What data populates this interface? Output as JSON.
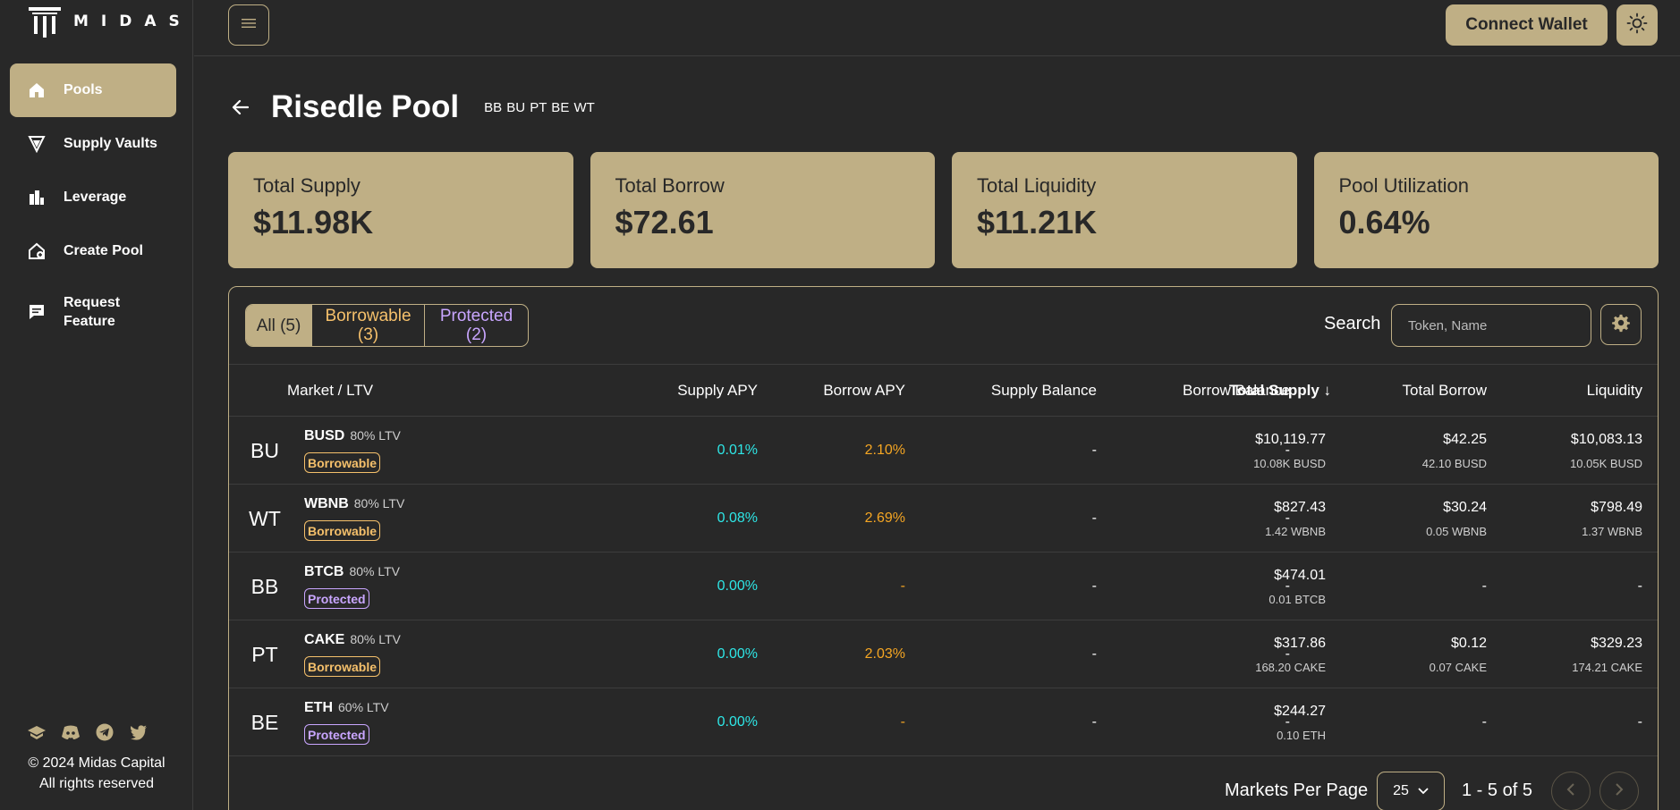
{
  "app": {
    "logo_text": "MIDAS"
  },
  "sidebar": {
    "items": [
      {
        "label": "Pools",
        "icon": "pools-icon",
        "active": true
      },
      {
        "label": "Supply Vaults",
        "icon": "supply-vaults-icon"
      },
      {
        "label": "Leverage",
        "icon": "leverage-icon"
      },
      {
        "label": "Create Pool",
        "icon": "create-pool-icon"
      },
      {
        "label": "Request Feature",
        "icon": "request-feature-icon"
      }
    ],
    "social": [
      "docs-icon",
      "discord-icon",
      "telegram-icon",
      "twitter-icon"
    ],
    "copyright_line1": "© 2024 Midas Capital",
    "copyright_line2": "All rights reserved"
  },
  "topbar": {
    "connect_label": "Connect Wallet"
  },
  "pool": {
    "title": "Risedle Pool",
    "tags": "BB BU PT BE WT"
  },
  "stats": [
    {
      "label": "Total Supply",
      "value": "$11.98K"
    },
    {
      "label": "Total Borrow",
      "value": "$72.61"
    },
    {
      "label": "Total Liquidity",
      "value": "$11.21K"
    },
    {
      "label": "Pool Utilization",
      "value": "0.64%"
    }
  ],
  "filters": {
    "all": "All (5)",
    "borrowable_line1": "Borrowable",
    "borrowable_line2": "(3)",
    "protected_line1": "Protected",
    "protected_line2": "(2)"
  },
  "search": {
    "label": "Search",
    "placeholder": "Token, Name"
  },
  "columns": {
    "market": "Market / LTV",
    "supply_apy": "Supply APY",
    "borrow_apy": "Borrow APY",
    "supply_balance": "Supply Balance",
    "borrow_balance": "Borrow Balance",
    "total_supply": "Total Supply ↓",
    "total_borrow": "Total Borrow",
    "liquidity": "Liquidity"
  },
  "rows": [
    {
      "abbr": "BU",
      "symbol": "BUSD",
      "ltv": "80% LTV",
      "badge": "Borrowable",
      "supply_apy": "0.01%",
      "borrow_apy": "2.10%",
      "supply_balance": "-",
      "borrow_balance": "-",
      "total_supply": "$10,119.77",
      "total_supply_sub": "10.08K BUSD",
      "total_borrow": "$42.25",
      "total_borrow_sub": "42.10 BUSD",
      "liquidity": "$10,083.13",
      "liquidity_sub": "10.05K BUSD"
    },
    {
      "abbr": "WT",
      "symbol": "WBNB",
      "ltv": "80% LTV",
      "badge": "Borrowable",
      "supply_apy": "0.08%",
      "borrow_apy": "2.69%",
      "supply_balance": "-",
      "borrow_balance": "-",
      "total_supply": "$827.43",
      "total_supply_sub": "1.42 WBNB",
      "total_borrow": "$30.24",
      "total_borrow_sub": "0.05 WBNB",
      "liquidity": "$798.49",
      "liquidity_sub": "1.37 WBNB"
    },
    {
      "abbr": "BB",
      "symbol": "BTCB",
      "ltv": "80% LTV",
      "badge": "Protected",
      "supply_apy": "0.00%",
      "borrow_apy": "-",
      "supply_balance": "-",
      "borrow_balance": "-",
      "total_supply": "$474.01",
      "total_supply_sub": "0.01 BTCB",
      "total_borrow": "-",
      "total_borrow_sub": "",
      "liquidity": "-",
      "liquidity_sub": ""
    },
    {
      "abbr": "PT",
      "symbol": "CAKE",
      "ltv": "80% LTV",
      "badge": "Borrowable",
      "supply_apy": "0.00%",
      "borrow_apy": "2.03%",
      "supply_balance": "-",
      "borrow_balance": "-",
      "total_supply": "$317.86",
      "total_supply_sub": "168.20 CAKE",
      "total_borrow": "$0.12",
      "total_borrow_sub": "0.07 CAKE",
      "liquidity": "$329.23",
      "liquidity_sub": "174.21 CAKE"
    },
    {
      "abbr": "BE",
      "symbol": "ETH",
      "ltv": "60% LTV",
      "badge": "Protected",
      "supply_apy": "0.00%",
      "borrow_apy": "-",
      "supply_balance": "-",
      "borrow_balance": "-",
      "total_supply": "$244.27",
      "total_supply_sub": "0.10 ETH",
      "total_borrow": "-",
      "total_borrow_sub": "",
      "liquidity": "-",
      "liquidity_sub": ""
    }
  ],
  "pager": {
    "label": "Markets Per Page",
    "per_page": "25",
    "range": "1 - 5 of 5"
  },
  "colors": {
    "accent": "#bfaf85",
    "background": "#282828",
    "supply_apy": "#2ee6e6",
    "borrow_apy": "#f5a623",
    "borrowable": "#f5c06b",
    "protected": "#c9a6ff"
  }
}
